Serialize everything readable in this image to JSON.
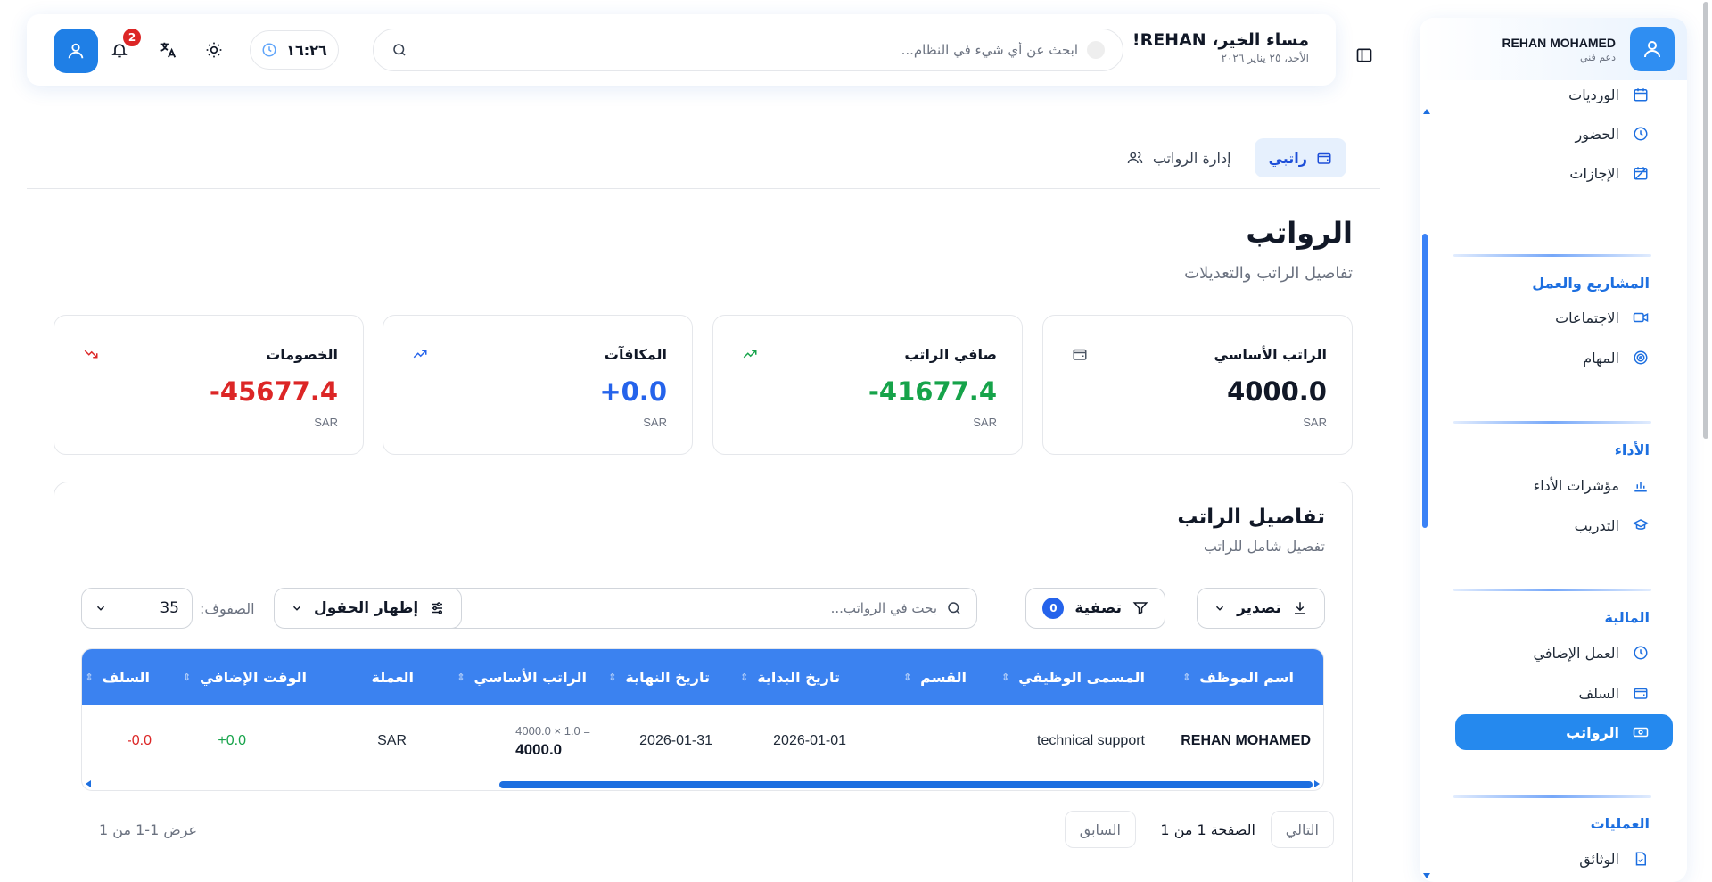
{
  "colors": {
    "accent": "#2589ee",
    "positive": "#16a34a",
    "negative": "#dc2626",
    "blue_value": "#2563eb"
  },
  "sidebar": {
    "user_name": "REHAN MOHAMED",
    "user_role": "دعم فني",
    "items_top": [
      {
        "label": "الورديات",
        "icon": "calendar-icon"
      },
      {
        "label": "الحضور",
        "icon": "clock-icon"
      },
      {
        "label": "الإجازات",
        "icon": "calendar-off-icon"
      }
    ],
    "sections": [
      {
        "title": "المشاريع والعمل",
        "items": [
          {
            "label": "الاجتماعات",
            "icon": "video-icon"
          },
          {
            "label": "المهام",
            "icon": "target-icon"
          }
        ]
      },
      {
        "title": "الأداء",
        "items": [
          {
            "label": "مؤشرات الأداء",
            "icon": "bar-chart-icon"
          },
          {
            "label": "التدريب",
            "icon": "graduation-cap-icon"
          }
        ]
      },
      {
        "title": "المالية",
        "items": [
          {
            "label": "العمل الإضافي",
            "icon": "clock-icon"
          },
          {
            "label": "السلف",
            "icon": "wallet-icon"
          },
          {
            "label": "الرواتب",
            "icon": "banknote-icon",
            "active": true
          }
        ]
      },
      {
        "title": "العمليات",
        "items": [
          {
            "label": "الوثائق",
            "icon": "file-check-icon"
          }
        ]
      }
    ]
  },
  "header": {
    "greeting": "مساء الخير، REHAN!",
    "date": "الأحد، ٢٥ يناير ٢٠٢٦",
    "search_placeholder": "ابحث عن أي شيء في النظام...",
    "time": "١٦:٢٦",
    "notification_count": "2"
  },
  "tabs": [
    {
      "label": "راتبي",
      "active": true
    },
    {
      "label": "إدارة الرواتب",
      "active": false
    }
  ],
  "page": {
    "title": "الرواتب",
    "subtitle": "تفاصيل الراتب والتعديلات"
  },
  "cards": [
    {
      "label": "الراتب الأساسي",
      "value": "4000.0",
      "currency": "SAR"
    },
    {
      "label": "صافي الراتب",
      "value": "-41677.4",
      "currency": "SAR"
    },
    {
      "label": "المكافآت",
      "value": "+0.0",
      "currency": "SAR"
    },
    {
      "label": "الخصومات",
      "value": "-45677.4",
      "currency": "SAR"
    }
  ],
  "details": {
    "title": "تفاصيل الراتب",
    "subtitle": "تفصيل شامل للراتب",
    "export_label": "تصدير",
    "filter_label": "تصفية",
    "filter_count": "0",
    "search_placeholder": "بحث في الرواتب...",
    "fields_label": "إظهار الحقول",
    "rows_label": "الصفوف:",
    "rows_value": "35",
    "columns": [
      "اسم الموظف",
      "المسمى الوظيفي",
      "القسم",
      "تاريخ البداية",
      "تاريخ النهاية",
      "الراتب الأساسي",
      "العملة",
      "الوقت الإضافي",
      "السلف"
    ],
    "row": {
      "employee": "REHAN MOHAMED",
      "job_title": "technical support",
      "department": "",
      "start_date": "2026-01-01",
      "end_date": "2026-01-31",
      "base_formula": "4000.0 × 1.0 =",
      "base_salary": "4000.0",
      "currency": "SAR",
      "overtime": "+0.0",
      "advances": "-0.0"
    },
    "pagination": {
      "next": "التالي",
      "prev": "السابق",
      "page_info": "الصفحة 1 من 1",
      "show_info": "عرض 1-1 من 1"
    }
  }
}
